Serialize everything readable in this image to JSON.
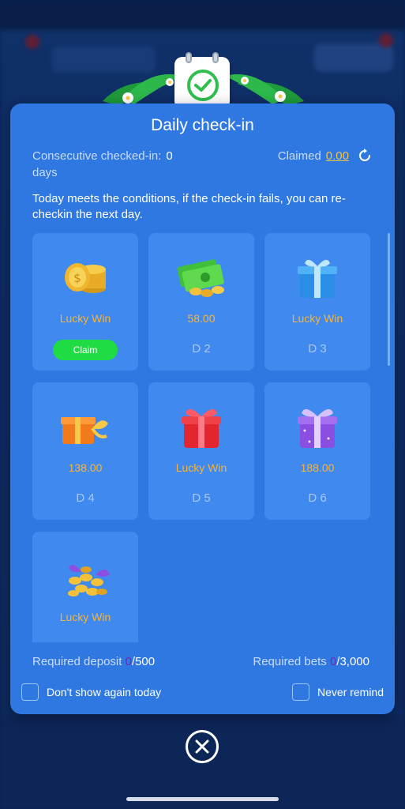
{
  "dialog": {
    "title": "Daily check-in",
    "consecutive_label": "Consecutive checked-in:",
    "consecutive_count": "0",
    "consecutive_unit": "days",
    "claimed_label": "Claimed",
    "claimed_amount": "0.00",
    "notice": "Today meets the conditions, if the check-in fails, you can re-checkin the next day."
  },
  "days": [
    {
      "reward": "Lucky Win",
      "day": "",
      "icon": "gold-coins-icon",
      "claim_label": "Claim"
    },
    {
      "reward": "58.00",
      "day": "D 2",
      "icon": "cash-and-coins-icon"
    },
    {
      "reward": "Lucky Win",
      "day": "D 3",
      "icon": "blue-gift-box-icon"
    },
    {
      "reward": "138.00",
      "day": "D 4",
      "icon": "orange-gift-box-icon"
    },
    {
      "reward": "Lucky Win",
      "day": "D 5",
      "icon": "red-gift-box-icon"
    },
    {
      "reward": "188.00",
      "day": "D 6",
      "icon": "purple-gift-box-icon"
    },
    {
      "reward": "Lucky Win",
      "day": "",
      "icon": "treasure-coins-icon"
    }
  ],
  "requirements": {
    "deposit_label": "Required deposit ",
    "deposit_current": "0",
    "deposit_target": "/500",
    "bets_label": "Required bets ",
    "bets_current": "0",
    "bets_target": "/3,000"
  },
  "options": {
    "dont_show_today": "Don't show again today",
    "never_remind": "Never remind"
  },
  "colors": {
    "dialog_bg": "#2f78e1",
    "card_bg": "#4089ee",
    "reward_text": "#f5b43a",
    "claim_button": "#1fdc45",
    "claimed_amount": "#f5c342"
  }
}
